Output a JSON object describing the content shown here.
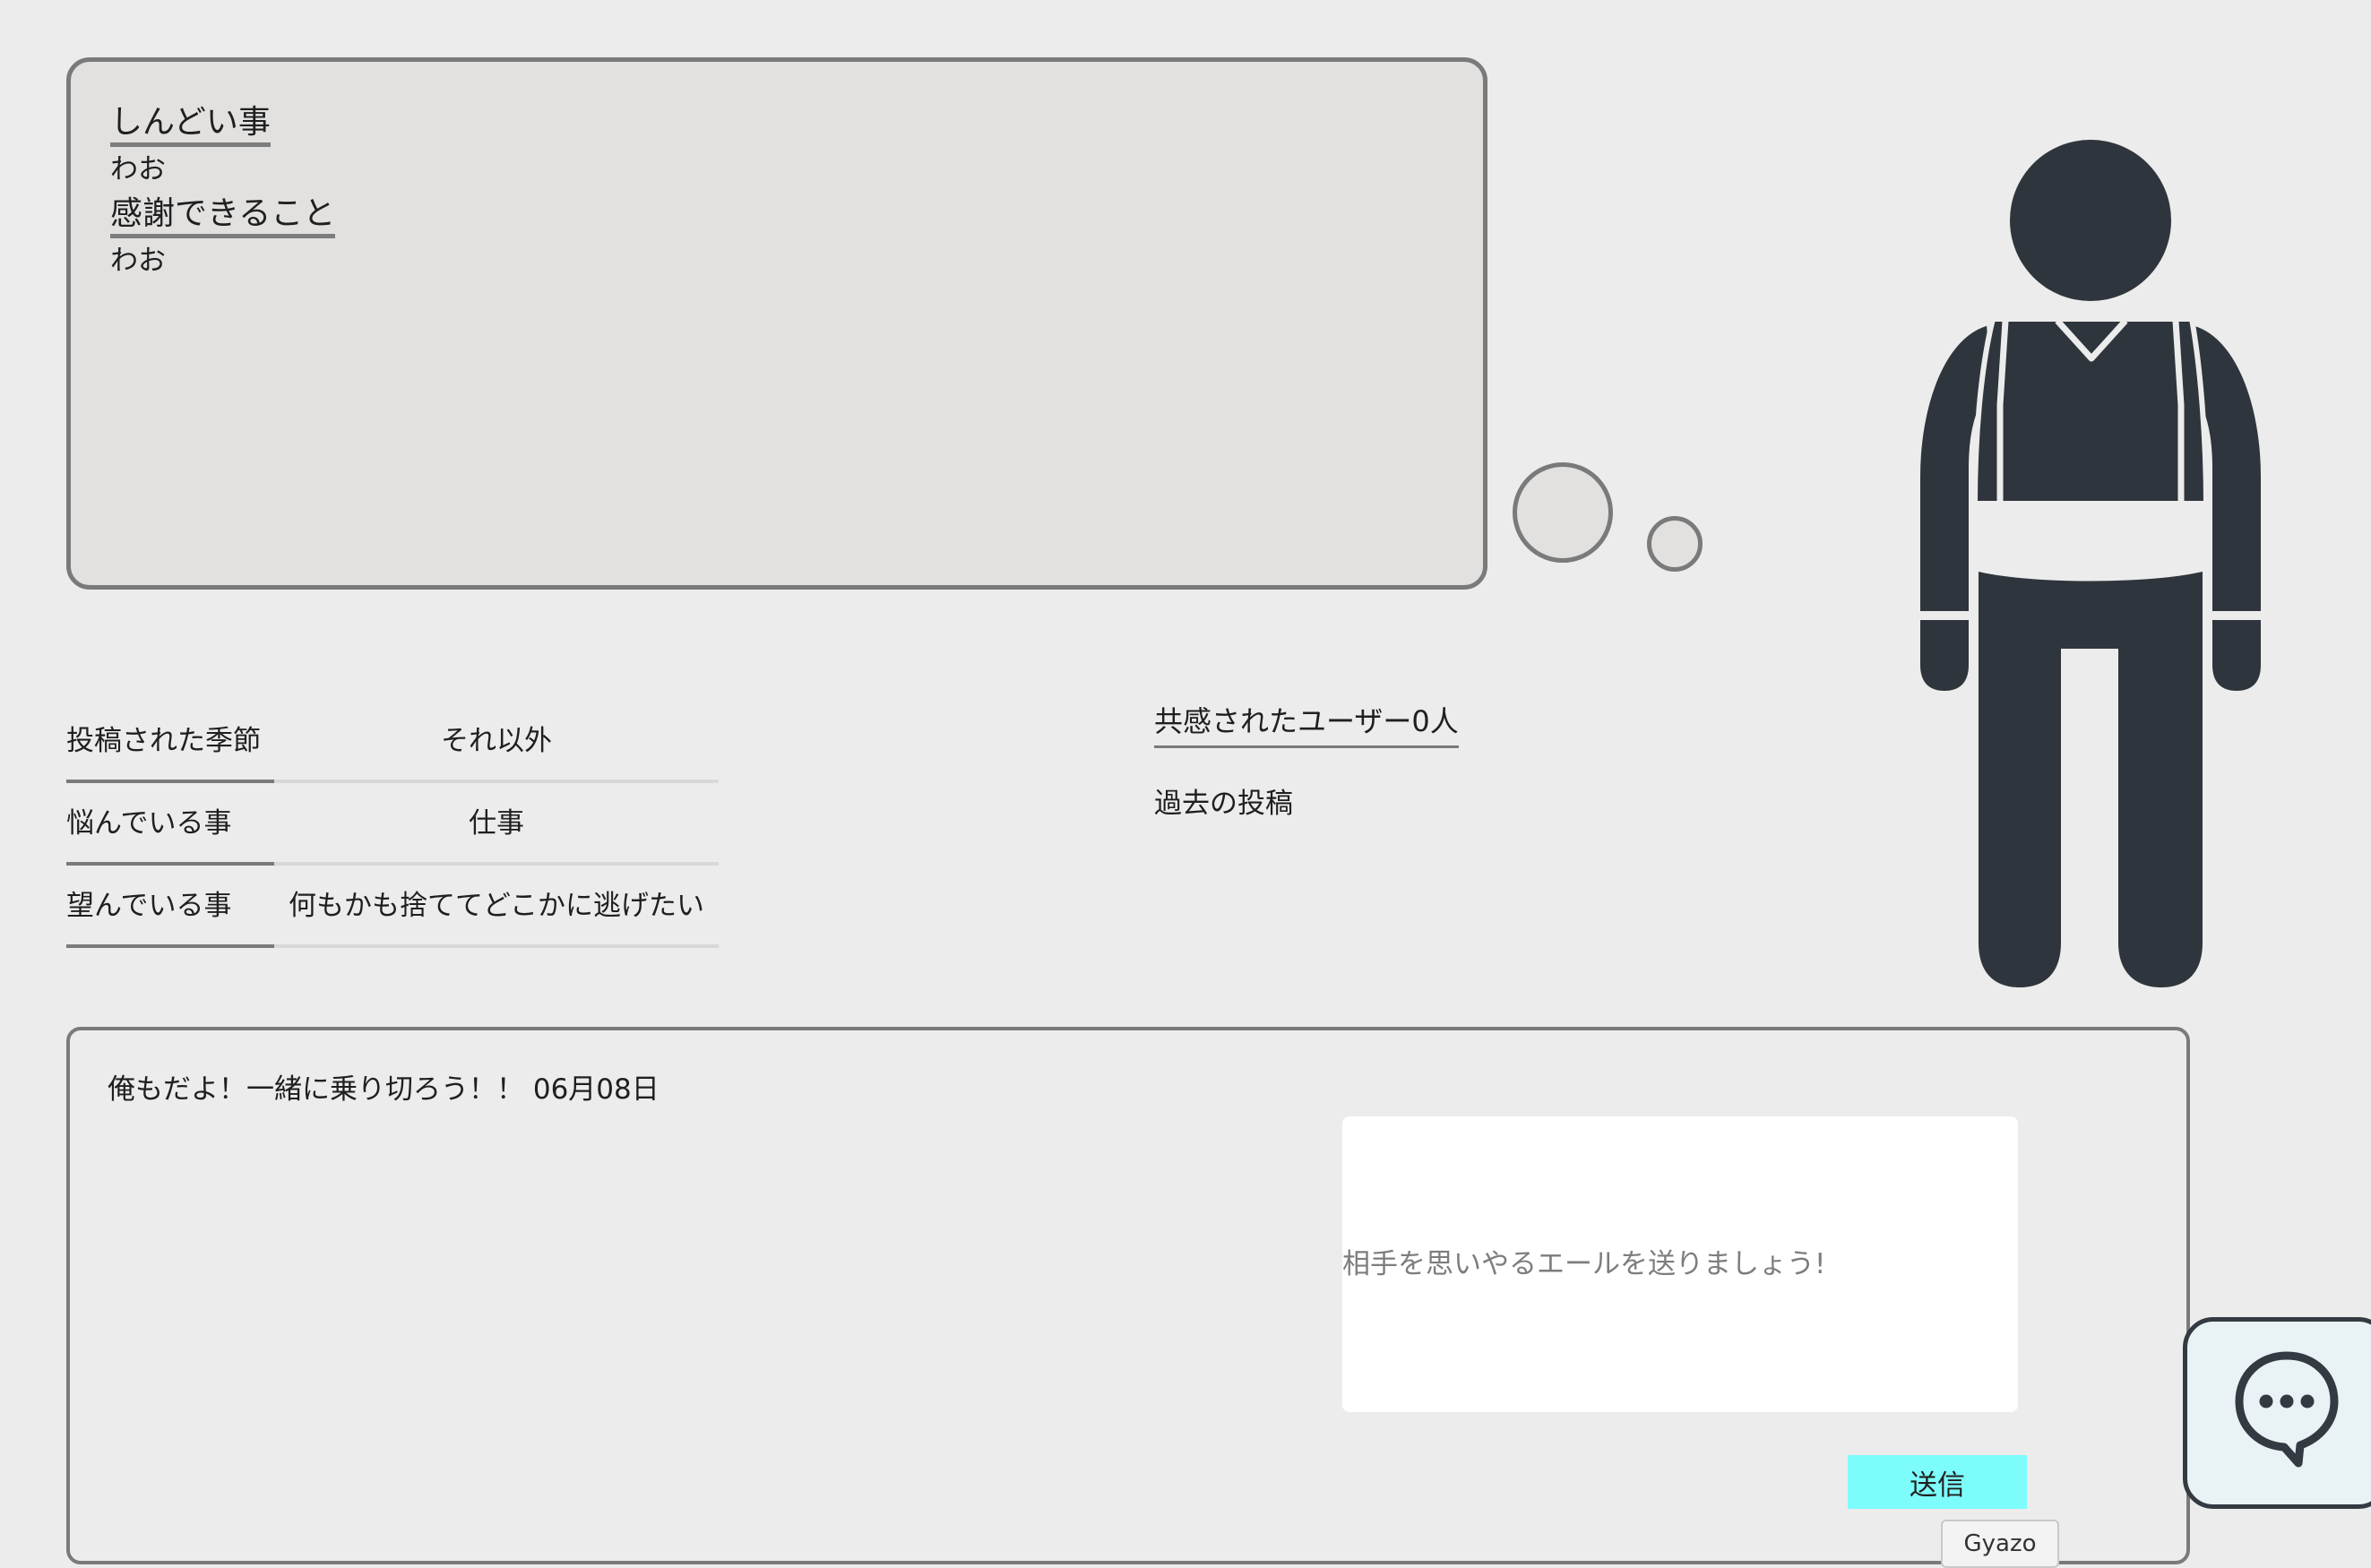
{
  "thought": {
    "heading1": "しんどい事",
    "text1": "わお",
    "heading2": "感謝できること",
    "text2": "わお"
  },
  "info": [
    {
      "label": "投稿された季節",
      "value": "それ以外"
    },
    {
      "label": "悩んでいる事",
      "value": "仕事"
    },
    {
      "label": "望んでいる事",
      "value": "何もかも捨ててどこかに逃げたい"
    }
  ],
  "sidebar": {
    "empathy": "共感されたユーザー0人",
    "past_posts": "過去の投稿"
  },
  "message": {
    "text": "俺もだよ！一緒に乗り切ろう！！ 06月08日",
    "placeholder": "相手を思いやるエールを送りましょう!",
    "send_label": "送信"
  },
  "tooltip": {
    "label": "Gyazo"
  },
  "icons": {
    "person": "person-icon",
    "chat": "chat-bubble-icon"
  },
  "colors": {
    "background": "#ebeceb",
    "send_button": "#7dfcfc",
    "figure": "#2f353c"
  }
}
